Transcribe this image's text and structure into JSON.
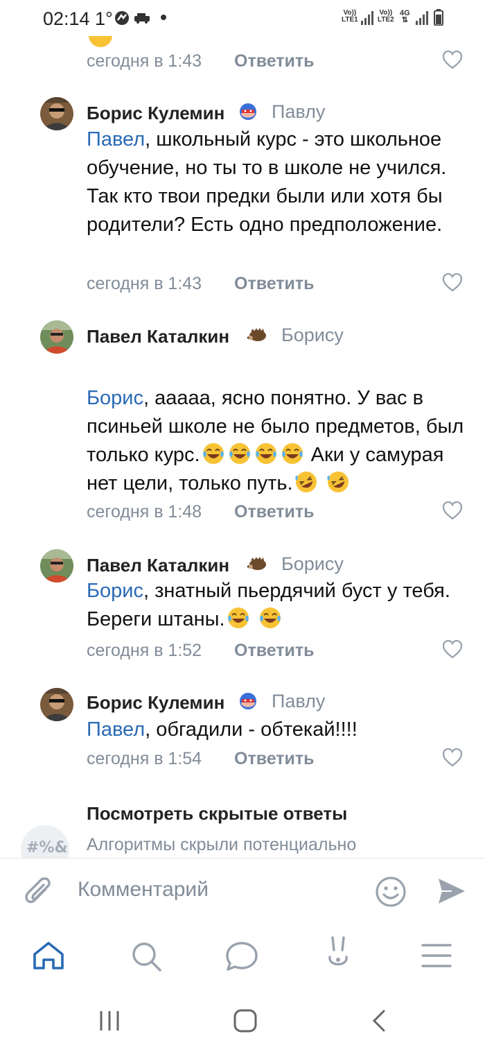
{
  "status_bar": {
    "time": "02:14",
    "temperature": "1°",
    "sim1": [
      "Vo))",
      "LTE1"
    ],
    "sim2": [
      "Vo))",
      "LTE2"
    ],
    "net_type": "4G"
  },
  "comments": [
    {
      "id": "c0",
      "partial": true,
      "date": "сегодня в 1:43",
      "reply_label": "Ответить"
    },
    {
      "id": "c1",
      "author": "Борис Кулемин",
      "addressee": "Павлу",
      "mention": "Павел",
      "text": ", школьный курс - это школьное обучение, но ты то в школе не учился. Так кто твои предки были или хотя бы родители? Есть одно предположение.",
      "date": "сегодня в 1:43",
      "reply_label": "Ответить"
    },
    {
      "id": "c2",
      "author": "Павел Каталкин",
      "addressee": "Борису",
      "mention": "Борис",
      "text": ", ааааа, ясно понятно. У вас в псиньей школе не было предметов, был только курс.",
      "text2": "Аки у самурая нет цели, только путь.",
      "date": "сегодня в 1:48",
      "reply_label": "Ответить"
    },
    {
      "id": "c3",
      "author": "Павел Каталкин",
      "addressee": "Борису",
      "mention": "Борис",
      "text": ", знатный пьердячий буст у тебя. Береги штаны.",
      "date": "сегодня в 1:52",
      "reply_label": "Ответить"
    },
    {
      "id": "c4",
      "author": "Борис Кулемин",
      "addressee": "Павлу",
      "mention": "Павел",
      "text": ", обгадили - обтекай!!!!",
      "date": "сегодня в 1:54",
      "reply_label": "Ответить"
    }
  ],
  "hidden_replies": {
    "title": "Посмотреть скрытые ответы",
    "subtitle": "Алгоритмы скрыли потенциально",
    "avatar_text": "#%&"
  },
  "composer": {
    "placeholder": "Комментарий"
  },
  "colors": {
    "accent": "#2a6ab5",
    "secondary_text": "#818c99",
    "icon": "#99a2ad",
    "emoji_yellow": "#f7c234"
  }
}
